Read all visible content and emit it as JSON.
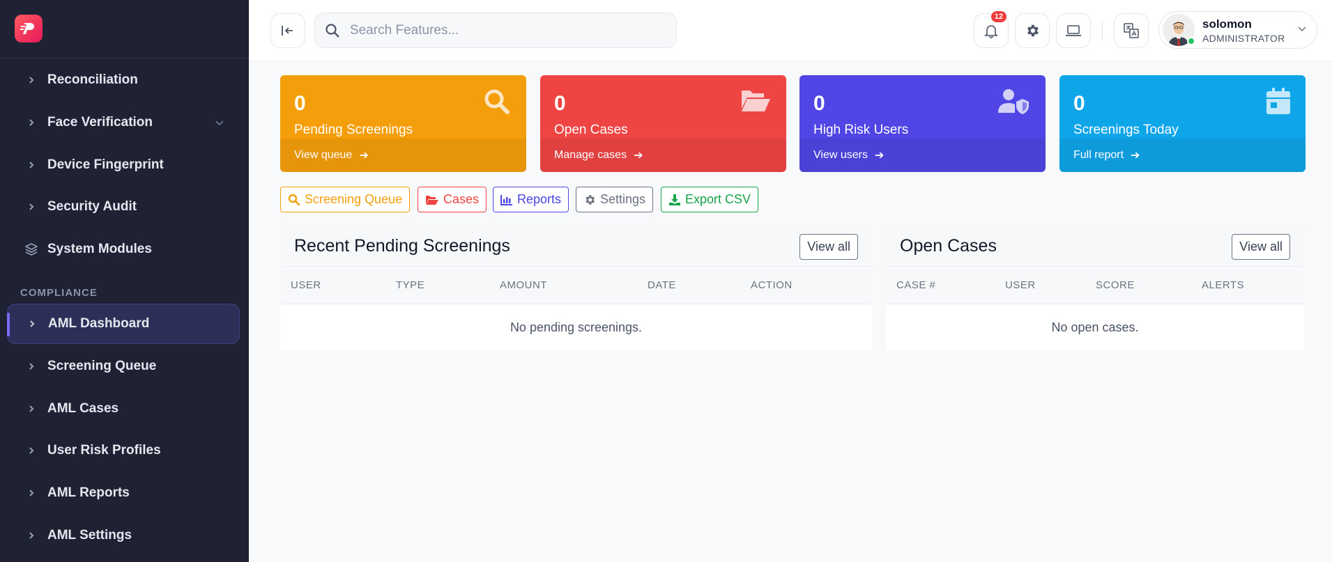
{
  "sidebar": {
    "items": [
      {
        "label": "Reconciliation"
      },
      {
        "label": "Face Verification"
      },
      {
        "label": "Device Fingerprint"
      },
      {
        "label": "Security Audit"
      },
      {
        "label": "System Modules"
      }
    ],
    "section_title": "COMPLIANCE",
    "compliance_items": [
      {
        "label": "AML Dashboard",
        "active": true
      },
      {
        "label": "Screening Queue"
      },
      {
        "label": "AML Cases"
      },
      {
        "label": "User Risk Profiles"
      },
      {
        "label": "AML Reports"
      },
      {
        "label": "AML Settings"
      }
    ]
  },
  "topbar": {
    "search_placeholder": "Search Features...",
    "notification_count": "12",
    "user": {
      "name": "solomon",
      "role": "ADMINISTRATOR"
    }
  },
  "cards": [
    {
      "value": "0",
      "title": "Pending Screenings",
      "link": "View queue",
      "color": "#f59e0b"
    },
    {
      "value": "0",
      "title": "Open Cases",
      "link": "Manage cases",
      "color": "#ef4444"
    },
    {
      "value": "0",
      "title": "High Risk Users",
      "link": "View users",
      "color": "#4f46e5"
    },
    {
      "value": "0",
      "title": "Screenings Today",
      "link": "Full report",
      "color": "#0ea5e9"
    }
  ],
  "actions": [
    {
      "label": "Screening Queue",
      "color": "#f59e0b"
    },
    {
      "label": "Cases",
      "color": "#ef4444"
    },
    {
      "label": "Reports",
      "color": "#4f46e5"
    },
    {
      "label": "Settings",
      "color": "#6b7280"
    },
    {
      "label": "Export CSV",
      "color": "#16a34a"
    }
  ],
  "pending_panel": {
    "title": "Recent Pending Screenings",
    "view_all": "View all",
    "columns": [
      "USER",
      "TYPE",
      "AMOUNT",
      "DATE",
      "ACTION"
    ],
    "empty": "No pending screenings."
  },
  "cases_panel": {
    "title": "Open Cases",
    "view_all": "View all",
    "columns": [
      "CASE #",
      "USER",
      "SCORE",
      "ALERTS"
    ],
    "empty": "No open cases."
  }
}
